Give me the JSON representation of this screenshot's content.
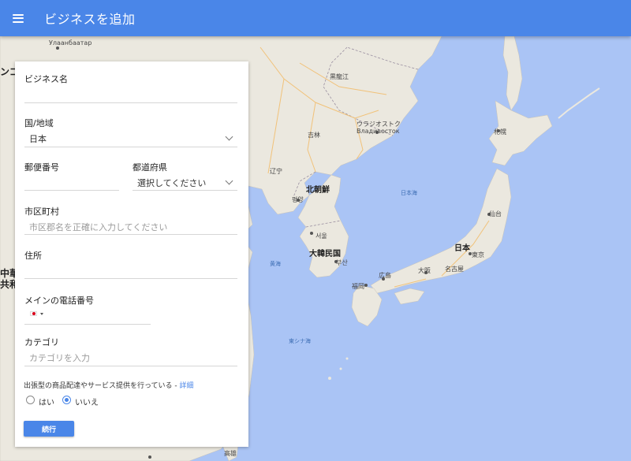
{
  "header": {
    "title": "ビジネスを追加",
    "menu_icon": "hamburger-menu-icon"
  },
  "form": {
    "business_name": {
      "label": "ビジネス名",
      "value": ""
    },
    "country": {
      "label": "国/地域",
      "value": "日本"
    },
    "postal_code": {
      "label": "郵便番号",
      "value": ""
    },
    "prefecture": {
      "label": "都道府県",
      "value": "選択してください"
    },
    "city": {
      "label": "市区町村",
      "placeholder": "市区郡名を正確に入力してください"
    },
    "address": {
      "label": "住所",
      "value": ""
    },
    "phone": {
      "label": "メインの電話番号",
      "country_flag": "japan-flag-icon",
      "value": ""
    },
    "category": {
      "label": "カテゴリ",
      "placeholder": "カテゴリを入力"
    },
    "service_question": {
      "text": "出張型の商品配達やサービス提供を行っている - ",
      "link": "詳細"
    },
    "radio_yes": {
      "label": "はい",
      "checked": false
    },
    "radio_no": {
      "label": "いいえ",
      "checked": true
    },
    "continue_button": "続行"
  },
  "map": {
    "labels": {
      "ulaanbaatar": "Улаанбаатар",
      "heilongjiang": "黒龍江",
      "vladivostok_ja": "ウラジオストク",
      "vladivostok_ru": "Владивосток",
      "jilin": "吉林",
      "liaoning": "辽宁",
      "north_korea": "北朝鮮",
      "pyongyang": "평양",
      "sea_of_japan": "日本海",
      "seoul": "서울",
      "south_korea": "大韓民国",
      "busan": "부산",
      "yellow_sea": "黄海",
      "fukuoka": "福岡",
      "hiroshima": "広島",
      "osaka": "大阪",
      "nagoya": "名古屋",
      "japan": "日本",
      "tokyo": "東京",
      "sendai": "仙台",
      "sapporo": "札幌",
      "east_china_sea": "東シナ海",
      "kaohsiung": "高雄",
      "china_partial_1": "中華",
      "china_partial_2": "共和",
      "mongolia_partial": "ンゴ"
    }
  },
  "colors": {
    "header": "#4a86e8",
    "sea": "#aac4f5",
    "land": "#ebe8df",
    "accent": "#4a86e8"
  }
}
